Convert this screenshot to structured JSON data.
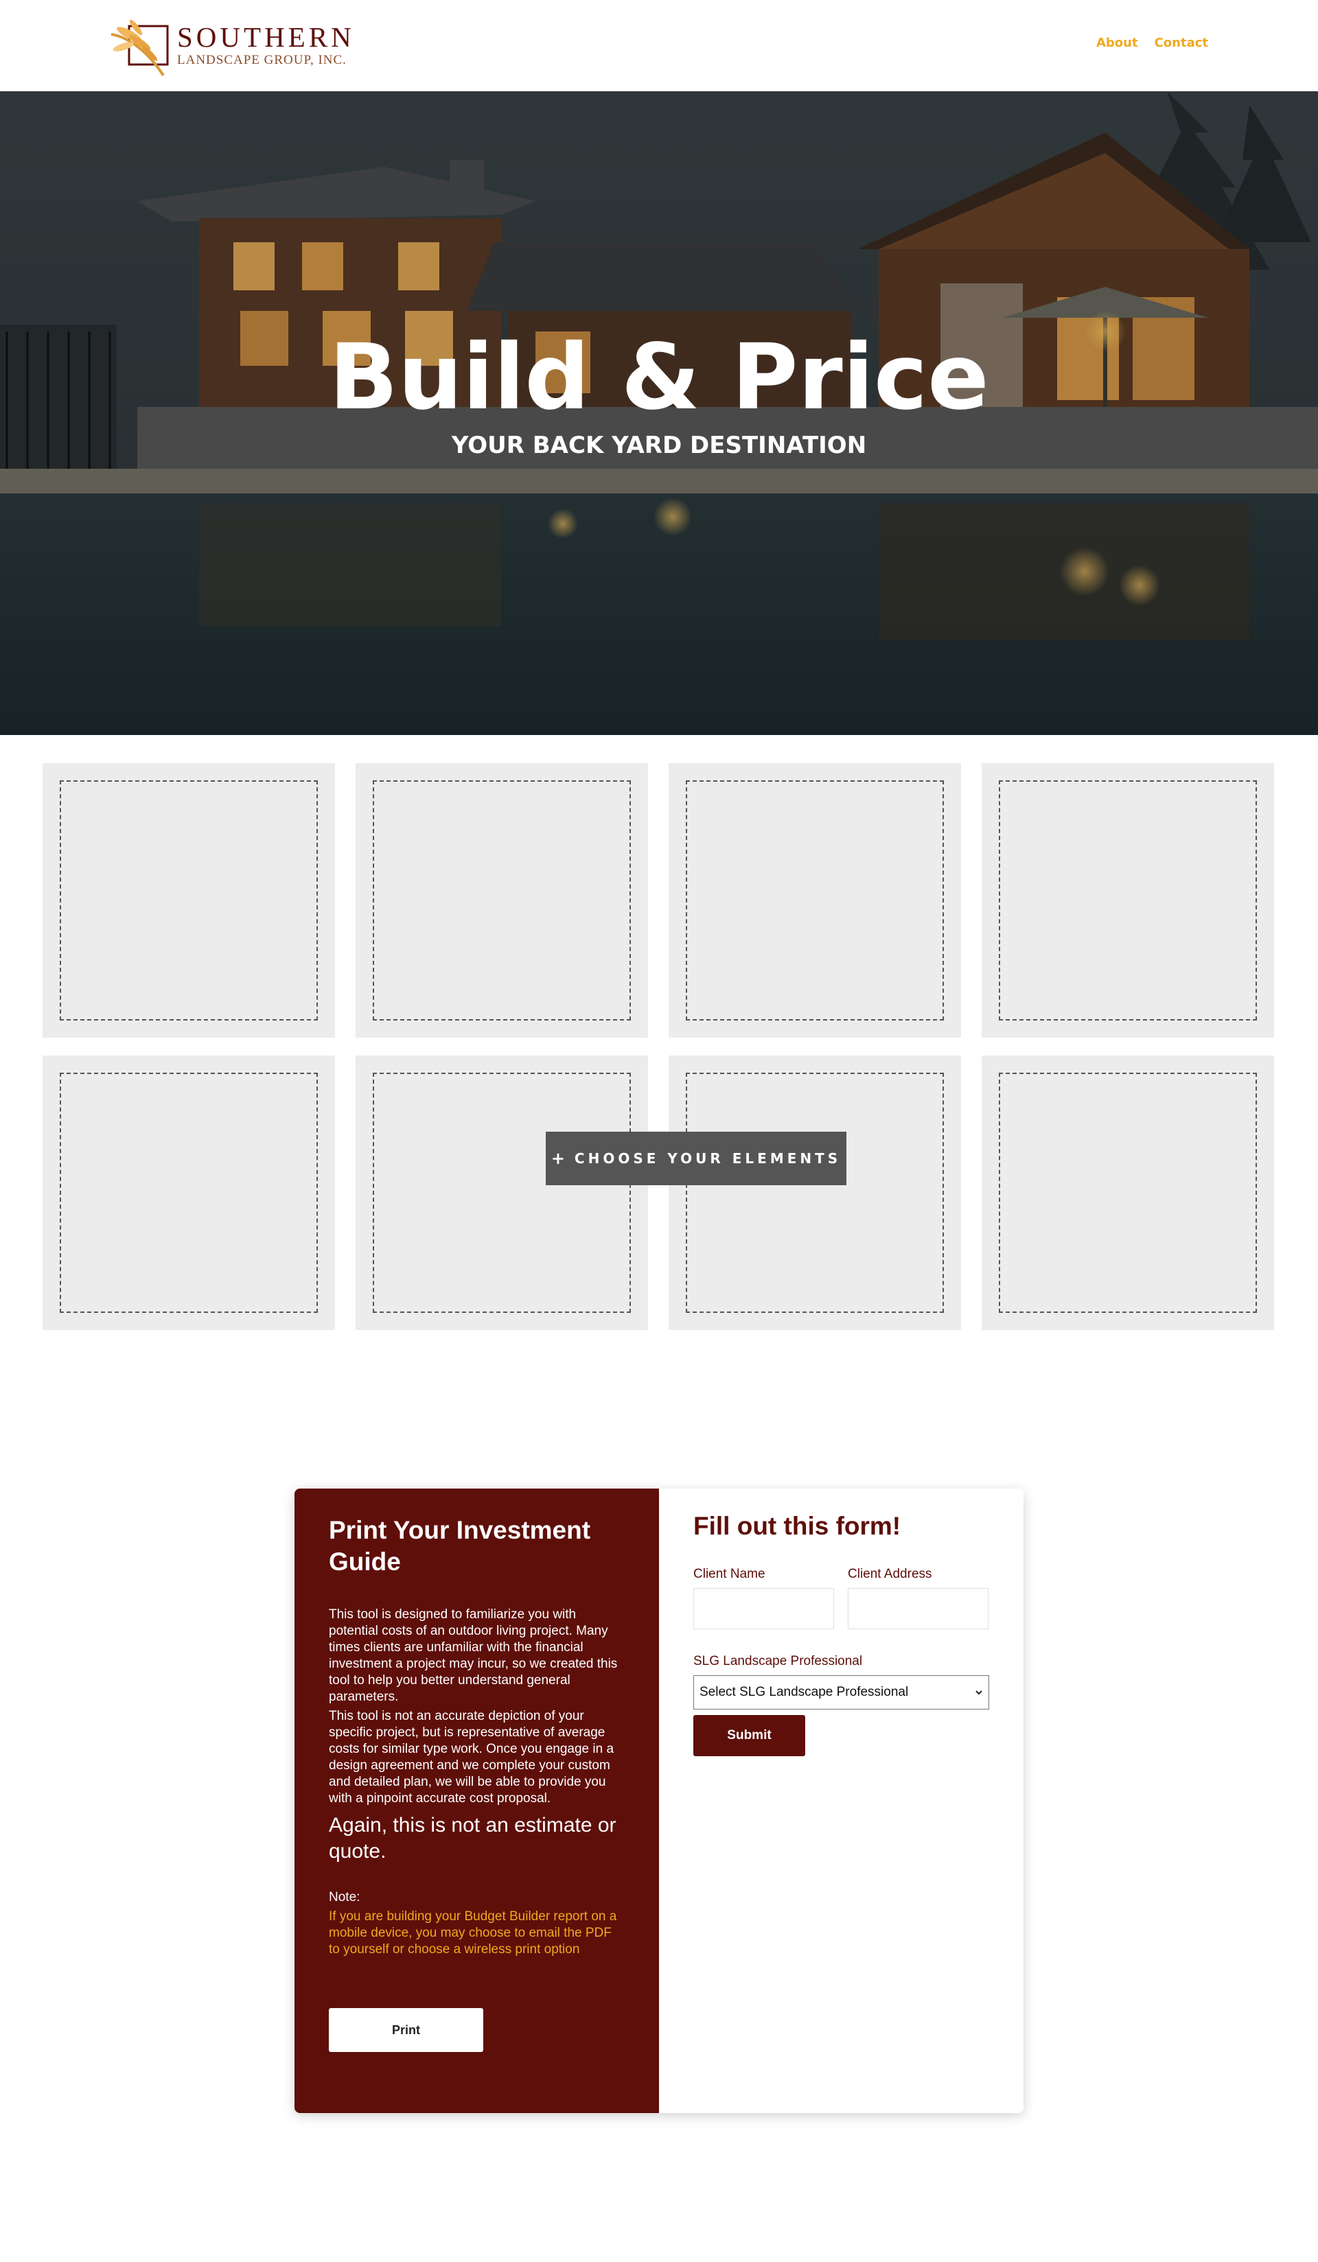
{
  "brand": {
    "name_top": "SOUTHERN",
    "name_bottom": "LANDSCAPE GROUP, INC."
  },
  "nav": {
    "items": [
      {
        "label": "About"
      },
      {
        "label": "Contact"
      }
    ]
  },
  "hero": {
    "title": "Build & Price",
    "subtitle": "YOUR BACK YARD DESTINATION"
  },
  "elements": {
    "button_label": "CHOOSE YOUR ELEMENTS",
    "button_icon": "plus-icon"
  },
  "guide": {
    "title": "Print Your Investment Guide",
    "paragraph_1": "This tool is designed to familiarize you with potential costs of an outdoor living project. Many times clients are unfamiliar with the financial investment a project may incur, so we created this tool to help you better understand general parameters.",
    "paragraph_2": "This tool is not an accurate depiction of your specific project, but is representative of average costs for similar type work. Once you engage in a design agreement and we complete your custom and detailed plan, we will be able to provide you with a pinpoint accurate cost proposal.",
    "emphasis": "Again, this is not an estimate or quote.",
    "note_label": "Note:",
    "note_text": "If you are building your Budget Builder report on a mobile device, you may choose to email the PDF to yourself or choose a wireless print option",
    "print_label": "Print"
  },
  "form": {
    "title": "Fill out this form!",
    "client_name_label": "Client Name",
    "client_name_value": "",
    "client_address_label": "Client Address",
    "client_address_value": "",
    "professional_label": "SLG Landscape Professional",
    "professional_selected": "Select SLG Landscape Professional",
    "submit_label": "Submit"
  },
  "colors": {
    "brand_maroon": "#5e0f0a",
    "accent_gold": "#f0a820",
    "tile_bg": "#ececec",
    "button_gray": "#555555"
  }
}
